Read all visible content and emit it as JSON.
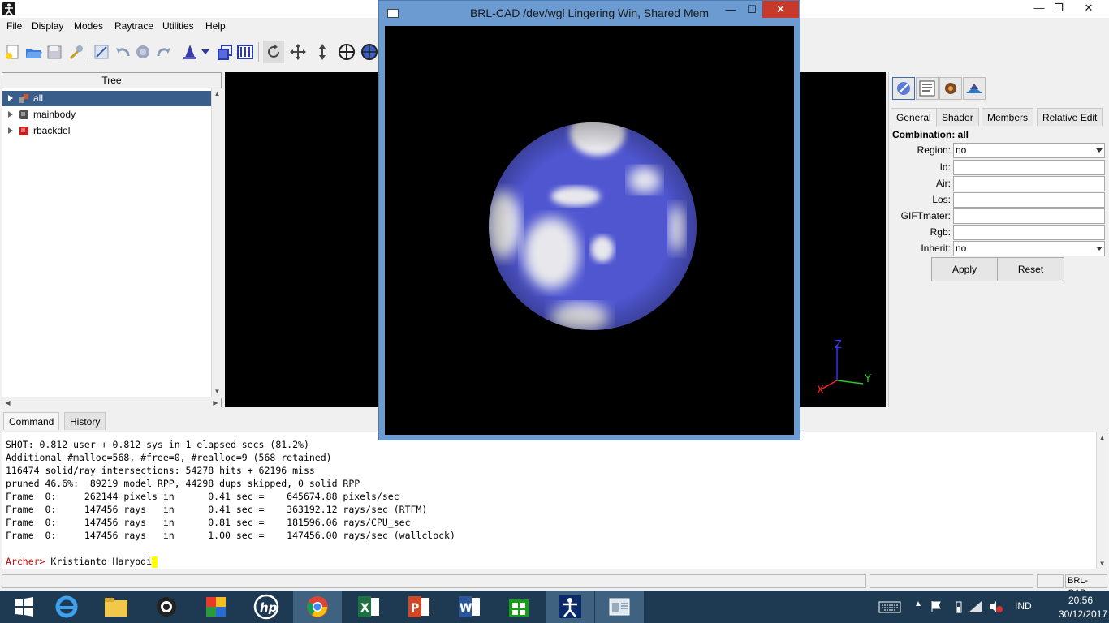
{
  "window": {
    "min": "—",
    "max": "❐",
    "close": "✕"
  },
  "menu": [
    "File",
    "Display",
    "Modes",
    "Raytrace",
    "Utilities",
    "Help"
  ],
  "tree": {
    "header": "Tree",
    "items": [
      {
        "label": "all",
        "icon": "combination-icon",
        "selected": true
      },
      {
        "label": "mainbody",
        "icon": "region-icon",
        "selected": false
      },
      {
        "label": "rbackdel",
        "icon": "region-red-icon",
        "selected": false
      }
    ]
  },
  "right_panel": {
    "tabs": [
      "General",
      "Shader",
      "Members",
      "Relative Edit"
    ],
    "form_title": "Combination: all",
    "fields": [
      {
        "label": "Region:",
        "value": "no",
        "dropdown": true
      },
      {
        "label": "Id:",
        "value": ""
      },
      {
        "label": "Air:",
        "value": ""
      },
      {
        "label": "Los:",
        "value": ""
      },
      {
        "label": "GIFTmater:",
        "value": ""
      },
      {
        "label": "Rgb:",
        "value": ""
      },
      {
        "label": "Inherit:",
        "value": "no",
        "dropdown": true
      }
    ],
    "apply": "Apply",
    "reset": "Reset"
  },
  "viewport": {
    "axes": {
      "z": "Z",
      "x": "X",
      "y": "Y"
    },
    "colors": {
      "z": "#3333ff",
      "x": "#ff2222",
      "y": "#22cc22"
    }
  },
  "bottom_tabs": [
    "Command",
    "History"
  ],
  "console": {
    "lines": [
      "SHOT: 0.812 user + 0.812 sys in 1 elapsed secs (81.2%)",
      "Additional #malloc=568, #free=0, #realloc=9 (568 retained)",
      "116474 solid/ray intersections: 54278 hits + 62196 miss",
      "pruned 46.6%:  89219 model RPP, 44298 dups skipped, 0 solid RPP",
      "Frame  0:     262144 pixels in      0.41 sec =    645674.88 pixels/sec",
      "Frame  0:     147456 rays   in      0.41 sec =    363192.12 rays/sec (RTFM)",
      "Frame  0:     147456 rays   in      0.81 sec =    181596.06 rays/CPU_sec",
      "Frame  0:     147456 rays   in      1.00 sec =    147456.00 rays/sec (wallclock)"
    ],
    "prompt": "Archer>",
    "input": " Kristianto Haryodi"
  },
  "status": {
    "right_label": "BRL-CAD"
  },
  "fb_window": {
    "title": "BRL-CAD /dev/wgl Lingering Win, Shared Mem",
    "min": "—",
    "max": "☐",
    "close": "✕",
    "sphere_colors": {
      "base": "#4f56d0",
      "cloud": "#e8e8ec"
    }
  },
  "taskbar": {
    "apps": [
      "start-icon",
      "ie-icon",
      "file-explorer-icon",
      "camera-icon",
      "puzzle-icon",
      "hp-icon",
      "chrome-icon",
      "excel-icon",
      "powerpoint-icon",
      "word-icon",
      "store-icon",
      "brlcad-icon",
      "window-icon"
    ],
    "tray": {
      "lang": "IND",
      "time": "20:56",
      "date": "30/12/2017"
    }
  }
}
